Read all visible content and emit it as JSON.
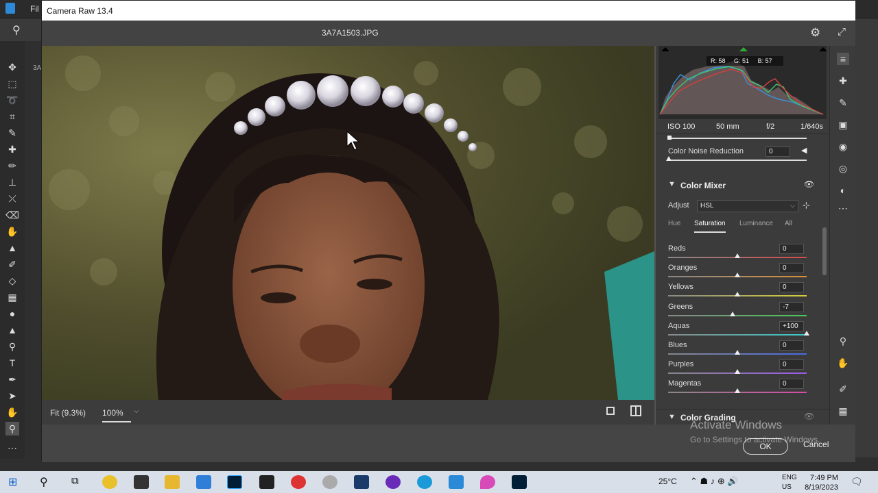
{
  "window": {
    "title": "Camera Raw 13.4",
    "filename": "3A7A1503.JPG"
  },
  "histogram": {
    "r_label": "R: 58",
    "g_label": "G: 51",
    "b_label": "B: 57"
  },
  "exif": {
    "iso": "ISO 100",
    "focal": "50 mm",
    "aperture": "f/2",
    "shutter": "1/640s"
  },
  "noise": {
    "label": "Color Noise Reduction",
    "value": "0"
  },
  "color_mixer": {
    "title": "Color Mixer",
    "adjust_label": "Adjust",
    "adjust_value": "HSL",
    "tabs": [
      "Hue",
      "Saturation",
      "Luminance",
      "All"
    ],
    "active_tab": "Saturation",
    "sliders": [
      {
        "label": "Reds",
        "value": "0",
        "level": 0
      },
      {
        "label": "Oranges",
        "value": "0",
        "level": 0
      },
      {
        "label": "Yellows",
        "value": "0",
        "level": 0
      },
      {
        "label": "Greens",
        "value": "-7",
        "level": -7
      },
      {
        "label": "Aquas",
        "value": "+100",
        "level": 100
      },
      {
        "label": "Blues",
        "value": "0",
        "level": 0
      },
      {
        "label": "Purples",
        "value": "0",
        "level": 0
      },
      {
        "label": "Magentas",
        "value": "0",
        "level": 0
      }
    ]
  },
  "color_grading": {
    "title": "Color Grading"
  },
  "bottom_bar": {
    "fit_label": "Fit (9.3%)",
    "zoom_label": "100%"
  },
  "footer": {
    "ok_label": "OK",
    "cancel_label": "Cancel"
  },
  "watermark": {
    "line1": "Activate Windows",
    "line2": "Go to Settings to activate Windows."
  },
  "ps": {
    "menu_partial": "Fil",
    "tab_partial": "3A"
  },
  "taskbar": {
    "temp": "25°C",
    "lang1": "ENG",
    "lang2": "US",
    "time": "7:49 PM",
    "date": "8/19/2023"
  },
  "colors": {
    "accent": "#3c8fd6",
    "panel": "#3b3b3b"
  }
}
